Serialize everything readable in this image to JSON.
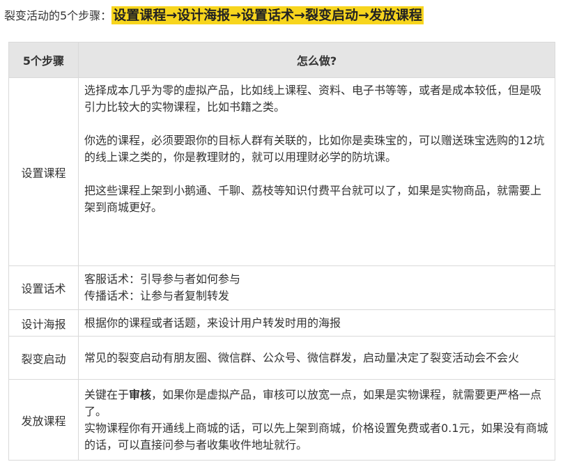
{
  "intro": {
    "label": "裂变活动的5个步骤：",
    "highlight": "设置课程→设计海报→设置话术→裂变启动→发放课程"
  },
  "table": {
    "headers": [
      "5个步骤",
      "怎么做?"
    ],
    "rows": [
      {
        "step": "设置课程",
        "paragraphs": [
          "选择成本几乎为零的虚拟产品，比如线上课程、资料、电子书等等，或者是成本较低，但是吸引力比较大的实物课程，比如书籍之类。",
          "你选的课程，必须要跟你的目标人群有关联的，比如你是卖珠宝的，可以赠送珠宝选购的12坑的线上课之类的，你是教理财的，就可以用理财必学的防坑课。",
          "把这些课程上架到小鹅通、千聊、荔枝等知识付费平台就可以了，如果是实物商品，就需要上架到商城更好。"
        ]
      },
      {
        "step": "设置话术",
        "lines": [
          "客服话术：引导参与者如何参与",
          "传播话术：让参与者复制转发"
        ]
      },
      {
        "step": "设计海报",
        "text": "根据你的课程或者话题，来设计用户转发时用的海报"
      },
      {
        "step": "裂变启动",
        "text": "常见的裂变启动有朋友圈、微信群、公众号、微信群发，启动量决定了裂变活动会不会火"
      },
      {
        "step": "发放课程",
        "line1_prefix": "关键在于",
        "line1_bold": "审核",
        "line1_suffix": "，如果你是虚拟产品，审核可以放宽一点，如果是实物课程，就需要更严格一点了。",
        "line2": "实物课程你有开通线上商城的话，可以先上架到商城，价格设置免费或者0.1元，如果没有商城的话，可以直接问参与者收集收件地址就行。"
      }
    ]
  },
  "colors": {
    "highlight": "#f7d51d",
    "header_bg": "#e5e5e5",
    "border": "#d9d9d9",
    "text": "#333333"
  }
}
